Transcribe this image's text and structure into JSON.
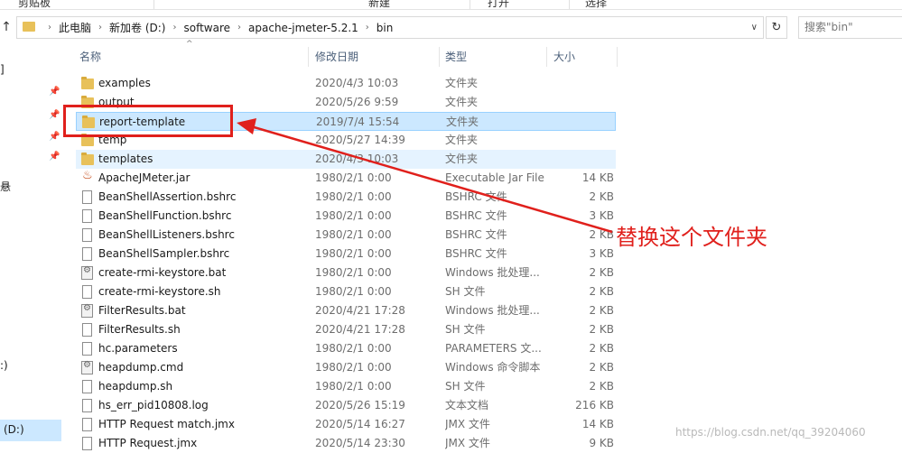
{
  "ribbon": {
    "items": [
      "剪贴板",
      "新建",
      "打开",
      "选择"
    ]
  },
  "address": {
    "crumbs": [
      "此电脑",
      "新加卷 (D:)",
      "software",
      "apache-jmeter-5.2.1",
      "bin"
    ]
  },
  "search": {
    "placeholder": "搜索\"bin\""
  },
  "nav": {
    "labels": [
      "",
      "",
      "",
      ":)",
      "(D:)"
    ]
  },
  "columns": {
    "name": "名称",
    "date": "修改日期",
    "type": "类型",
    "size": "大小"
  },
  "files": [
    {
      "name": "examples",
      "date": "2020/4/3 10:03",
      "type": "文件夹",
      "size": "",
      "icon": "folder-icon"
    },
    {
      "name": "output",
      "date": "2020/5/26 9:59",
      "type": "文件夹",
      "size": "",
      "icon": "folder-icon"
    },
    {
      "name": "report-template",
      "date": "2019/7/4 15:54",
      "type": "文件夹",
      "size": "",
      "icon": "folder-icon"
    },
    {
      "name": "temp",
      "date": "2020/5/27 14:39",
      "type": "文件夹",
      "size": "",
      "icon": "folder-icon"
    },
    {
      "name": "templates",
      "date": "2020/4/3 10:03",
      "type": "文件夹",
      "size": "",
      "icon": "folder-icon"
    },
    {
      "name": "ApacheJMeter.jar",
      "date": "1980/2/1 0:00",
      "type": "Executable Jar File",
      "size": "14 KB",
      "icon": "jar-icon"
    },
    {
      "name": "BeanShellAssertion.bshrc",
      "date": "1980/2/1 0:00",
      "type": "BSHRC 文件",
      "size": "2 KB",
      "icon": "file-icon"
    },
    {
      "name": "BeanShellFunction.bshrc",
      "date": "1980/2/1 0:00",
      "type": "BSHRC 文件",
      "size": "3 KB",
      "icon": "file-icon"
    },
    {
      "name": "BeanShellListeners.bshrc",
      "date": "1980/2/1 0:00",
      "type": "BSHRC 文件",
      "size": "2 KB",
      "icon": "file-icon"
    },
    {
      "name": "BeanShellSampler.bshrc",
      "date": "1980/2/1 0:00",
      "type": "BSHRC 文件",
      "size": "3 KB",
      "icon": "file-icon"
    },
    {
      "name": "create-rmi-keystore.bat",
      "date": "1980/2/1 0:00",
      "type": "Windows 批处理...",
      "size": "2 KB",
      "icon": "batch-icon"
    },
    {
      "name": "create-rmi-keystore.sh",
      "date": "1980/2/1 0:00",
      "type": "SH 文件",
      "size": "2 KB",
      "icon": "file-icon"
    },
    {
      "name": "FilterResults.bat",
      "date": "2020/4/21 17:28",
      "type": "Windows 批处理...",
      "size": "2 KB",
      "icon": "batch-icon"
    },
    {
      "name": "FilterResults.sh",
      "date": "2020/4/21 17:28",
      "type": "SH 文件",
      "size": "2 KB",
      "icon": "file-icon"
    },
    {
      "name": "hc.parameters",
      "date": "1980/2/1 0:00",
      "type": "PARAMETERS 文...",
      "size": "2 KB",
      "icon": "file-icon"
    },
    {
      "name": "heapdump.cmd",
      "date": "1980/2/1 0:00",
      "type": "Windows 命令脚本",
      "size": "2 KB",
      "icon": "batch-icon"
    },
    {
      "name": "heapdump.sh",
      "date": "1980/2/1 0:00",
      "type": "SH 文件",
      "size": "2 KB",
      "icon": "file-icon"
    },
    {
      "name": "hs_err_pid10808.log",
      "date": "2020/5/26 15:19",
      "type": "文本文档",
      "size": "216 KB",
      "icon": "file-icon"
    },
    {
      "name": "HTTP Request match.jmx",
      "date": "2020/5/14 16:27",
      "type": "JMX 文件",
      "size": "14 KB",
      "icon": "file-icon"
    },
    {
      "name": "HTTP Request.jmx",
      "date": "2020/5/14 23:30",
      "type": "JMX 文件",
      "size": "9 KB",
      "icon": "file-icon"
    }
  ],
  "selected_index": 2,
  "hover_index": 4,
  "annotation": {
    "text": "替换这个文件夹",
    "color": "#e0201c"
  },
  "watermark": "https://blog.csdn.net/qq_39204060"
}
